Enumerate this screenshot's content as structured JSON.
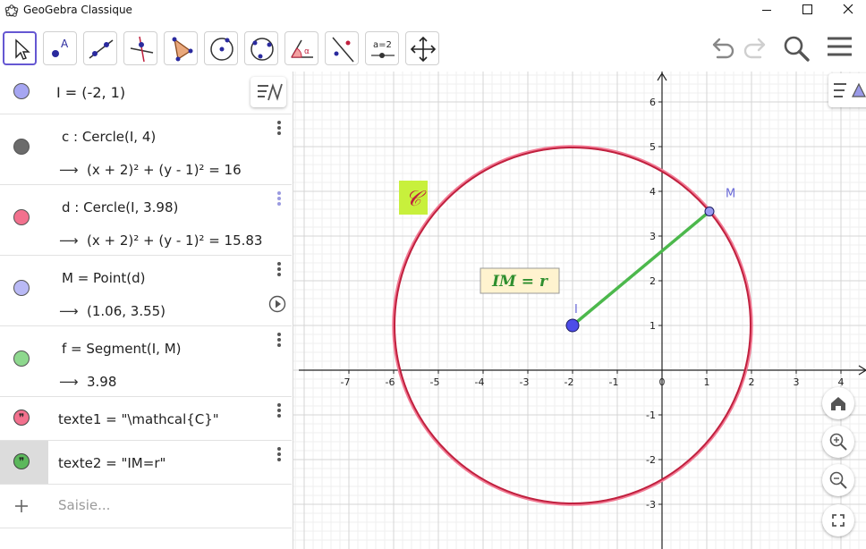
{
  "window": {
    "title": "GeoGebra Classique"
  },
  "toolbar": {
    "tools": [
      "move",
      "point",
      "line",
      "perpendicular-line",
      "polygon",
      "circle-center-point",
      "circle-three-points",
      "angle",
      "reflect-about-line",
      "slider",
      "move-graphics-view"
    ],
    "slider_label": "a=2"
  },
  "algebra": {
    "rows": [
      {
        "def": "I = (-2, 1)",
        "color": "#a6a6f2"
      },
      {
        "def": "c : Cercle(I, 4)",
        "value": "(x + 2)² + (y - 1)² = 16",
        "color": "#6b6b6b"
      },
      {
        "def": "d : Cercle(I, 3.98)",
        "value": "(x + 2)² + (y - 1)² = 15.83",
        "color": "#f2718e"
      },
      {
        "def": "M = Point(d)",
        "value": "(1.06, 3.55)",
        "color": "#b9b9f5"
      },
      {
        "def": "f = Segment(I, M)",
        "value": "3.98",
        "color": "#8ed88e"
      },
      {
        "def": "texte1 = \"\\mathcal{C}\"",
        "color": "#f2718e"
      },
      {
        "def": "texte2 = \"IM=r\"",
        "color": "#5cb85c"
      }
    ],
    "input_placeholder": "Saisie...",
    "arrow": "⟶",
    "quote_glyph": "❞"
  },
  "graphics": {
    "point_I_label": "I",
    "point_M_label": "M",
    "text1": "𝒞",
    "text2": "IM = r",
    "x_ticks": [
      "-7",
      "-5",
      "-4",
      "-3",
      "-2",
      "-1",
      "0",
      "1",
      "2",
      "3",
      "4"
    ],
    "y_ticks": [
      "6",
      "5",
      "4",
      "3",
      "2",
      "1",
      "-1",
      "-2",
      "-3"
    ],
    "x_tick_values": [
      -7,
      -5,
      -4,
      -3,
      -2,
      -1,
      0,
      1,
      2,
      3,
      4
    ],
    "y_tick_values": [
      6,
      5,
      4,
      3,
      2,
      1,
      -1,
      -2,
      -3
    ],
    "extra_x_tick_label": "-6",
    "colors": {
      "circle": "#c0203e",
      "circle_outer": "#f27a94",
      "segment": "#4cb84c",
      "point": "#4d4de8",
      "text1_bg": "#c8f03c",
      "text2_bg": "#fff3cf"
    }
  }
}
